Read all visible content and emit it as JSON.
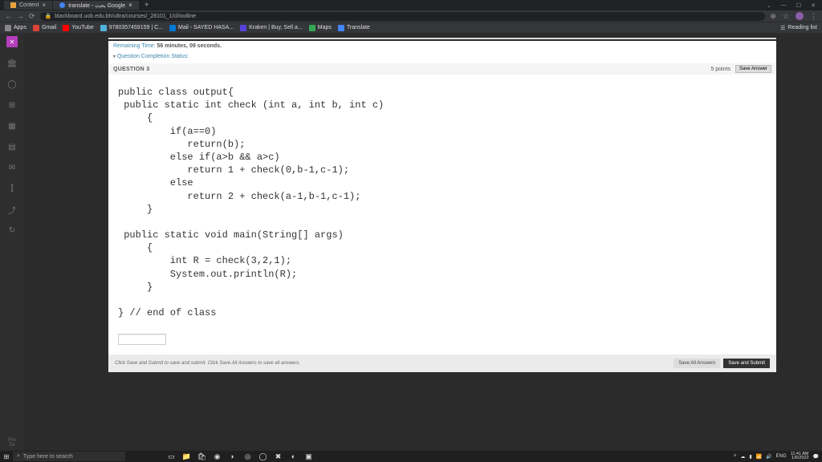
{
  "browser": {
    "tabs": [
      {
        "label": "Content",
        "favicon": "#e8a33d"
      },
      {
        "label": "translate - بحث Google",
        "favicon": "#4285f4",
        "active": true
      }
    ],
    "url": "blackboard.uob.edu.bh/ultra/courses/_28101_1/cl/outline",
    "window_controls": {
      "min": "—",
      "max": "☐",
      "close": "✕"
    },
    "bookmarks": [
      {
        "label": "Apps",
        "color": "#888"
      },
      {
        "label": "Gmail",
        "color": "#db4437"
      },
      {
        "label": "YouTube",
        "color": "#ff0000"
      },
      {
        "label": "9780357459159 | C...",
        "color": "#4fb3d9"
      },
      {
        "label": "Mail - SAYED HASA...",
        "color": "#0078d4"
      },
      {
        "label": "Kraken | Buy, Sell a...",
        "color": "#5741d9"
      },
      {
        "label": "Maps",
        "color": "#34a853"
      },
      {
        "label": "Translate",
        "color": "#4285f4"
      }
    ],
    "reading_list": "Reading list"
  },
  "left_icons": [
    "𝕏",
    "⌂",
    "⚪",
    "🗎",
    "🗊",
    "≡",
    "⇆",
    "⫿",
    "⤴",
    "↻"
  ],
  "quiz": {
    "remaining_label": "Remaining Time:",
    "remaining_value": "56 minutes, 09 seconds.",
    "qcs_label": "Question Completion Status:",
    "question_label": "QUESTION 3",
    "points": "5 points",
    "save_answer": "Save Answer",
    "code": "public class output{\n public static int check (int a, int b, int c)\n     {\n         if(a==0)\n            return(b);\n         else if(a>b && a>c)\n            return 1 + check(0,b-1,c-1);\n         else\n            return 2 + check(a-1,b-1,c-1);\n     }\n\n public static void main(String[] args)\n     {\n         int R = check(3,2,1);\n         System.out.println(R);\n     }\n\n} // end of class",
    "footer_text": "Click Save and Submit to save and submit. Click Save All Answers to save all answers.",
    "btn_save_all": "Save All Answers",
    "btn_submit": "Save and Submit"
  },
  "taskbar": {
    "search_placeholder": "Type here to search",
    "tray": {
      "lang": "ENG",
      "time": "11:41 AM",
      "date": "1/6/2022"
    }
  }
}
